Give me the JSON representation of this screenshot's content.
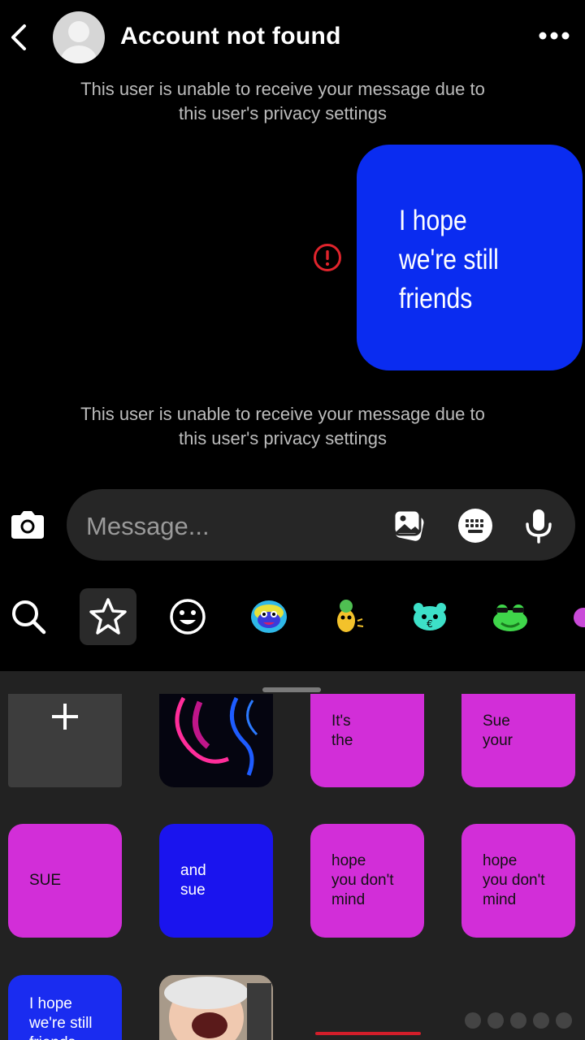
{
  "header": {
    "title": "Account not found",
    "back_icon": "chevron-left-icon",
    "more_icon": "more-horizontal-icon"
  },
  "messages": {
    "system_notice_1": "This user is unable to receive your message due to this user's privacy settings",
    "bubble_text": "I      hope\nwe're still\nfriends",
    "system_notice_2": "This user is unable to receive your message due to this user's privacy settings",
    "error_icon": "alert-circle-icon"
  },
  "composer": {
    "placeholder": "Message...",
    "camera_icon": "camera-icon",
    "gallery_icon": "image-icon",
    "keyboard_icon": "keyboard-icon",
    "mic_icon": "microphone-icon"
  },
  "sticker_tabs": [
    "search-icon",
    "star-icon",
    "smiley-icon",
    "sticker-1",
    "sticker-2",
    "sticker-3",
    "sticker-4"
  ],
  "sticker_grid": [
    {
      "label": "+",
      "kind": "add"
    },
    {
      "label": "",
      "kind": "neon-art"
    },
    {
      "label": "It's\nthe",
      "kind": "text"
    },
    {
      "label": "Sue\nyour",
      "kind": "text"
    },
    {
      "label": "SUE",
      "kind": "text"
    },
    {
      "label": "and\nsue",
      "kind": "text"
    },
    {
      "label": "hope\nyou don't\nmind",
      "kind": "text"
    },
    {
      "label": "hope\nyou don't\nmind",
      "kind": "text"
    },
    {
      "label": "I     hope\nwe're   still\nfriends",
      "kind": "text"
    },
    {
      "label": "",
      "kind": "photo"
    }
  ],
  "colors": {
    "bubble": "#0a2cf0",
    "magenta": "#d22ed8",
    "blue": "#1a14ee",
    "panel": "#222222",
    "error": "#e0242c"
  }
}
